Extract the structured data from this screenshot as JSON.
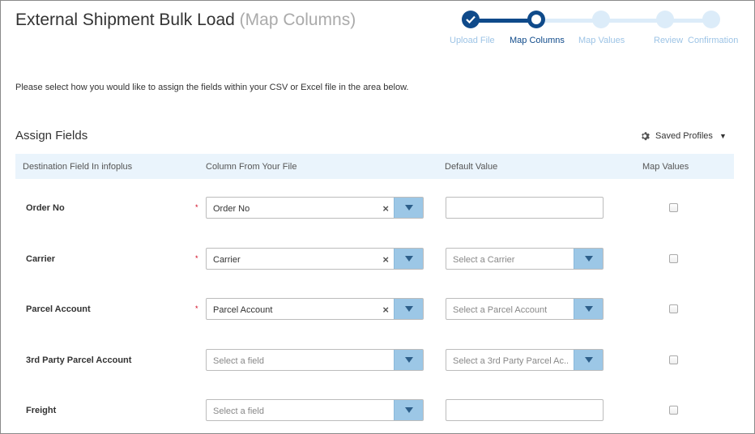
{
  "header": {
    "title": "External Shipment Bulk Load",
    "subtitle": "(Map Columns)"
  },
  "wizard": {
    "steps": [
      {
        "label": "Upload File",
        "state": "complete"
      },
      {
        "label": "Map Columns",
        "state": "active"
      },
      {
        "label": "Map Values",
        "state": "pending"
      },
      {
        "label": "Review",
        "state": "pending"
      },
      {
        "label": "Confirmation",
        "state": "pending"
      }
    ],
    "colors": {
      "done": "#0f4a8a",
      "pending": "#dcecf9",
      "pending_text": "#9dc4e6"
    }
  },
  "instructions": "Please select how you would like to assign the fields within your CSV or Excel file in the area below.",
  "assign": {
    "title": "Assign Fields",
    "saved_profiles_label": "Saved Profiles",
    "columns": {
      "destination": "Destination Field In infoplus",
      "file_column": "Column From Your File",
      "default_value": "Default Value",
      "map_values": "Map Values"
    },
    "rows": [
      {
        "label": "Order No",
        "required": "*",
        "column_value": "Order No",
        "default_placeholder": ""
      },
      {
        "label": "Carrier",
        "required": "*",
        "column_value": "Carrier",
        "default_placeholder": "Select a Carrier"
      },
      {
        "label": "Parcel Account",
        "required": "*",
        "column_value": "Parcel Account",
        "default_placeholder": "Select a Parcel Account"
      },
      {
        "label": "3rd Party Parcel Account",
        "column_placeholder": "Select a field",
        "default_placeholder": "Select a 3rd Party Parcel Ac.."
      },
      {
        "label": "Freight",
        "column_placeholder": "Select a field",
        "default_placeholder": ""
      }
    ],
    "clear_glyph": "×"
  }
}
